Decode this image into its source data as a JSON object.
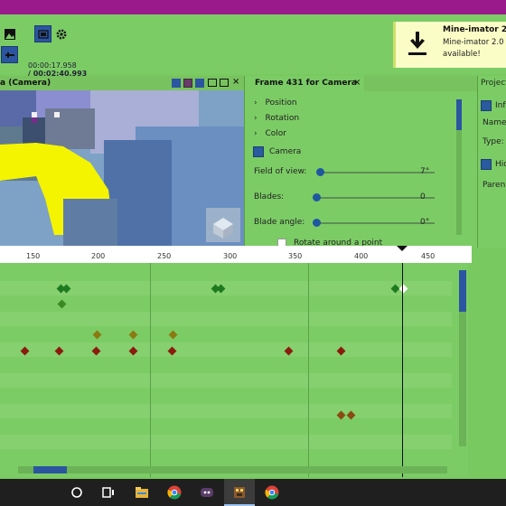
{
  "window": {
    "title_bar_color": "#9a1a8c"
  },
  "toolbar": {
    "time_current": "00:00:17.958",
    "time_total": "/ 00:02:40.993"
  },
  "notification": {
    "title": "Mine-imator 2.0",
    "text_line1": "Mine-imator 2.0 i",
    "text_line2": "available!",
    "icon": "download-icon"
  },
  "viewport": {
    "title": "a (Camera)"
  },
  "frame_panel": {
    "title": "Frame 431 for Camera",
    "close": "×",
    "sections": [
      {
        "label": "Position"
      },
      {
        "label": "Rotation"
      },
      {
        "label": "Color"
      }
    ],
    "camera_label": "Camera",
    "fields": [
      {
        "label": "Field of view:",
        "value": "7°",
        "fraction": 0.0
      },
      {
        "label": "Blades:",
        "value": "0",
        "fraction": 0.0
      },
      {
        "label": "Blade angle:",
        "value": "0°",
        "fraction": 0.0
      }
    ],
    "rotate_label": "Rotate around a point"
  },
  "project_panel": {
    "title": "Project",
    "info_label": "Infor",
    "name_label": "Name",
    "type_label": "Type:",
    "hide_label": "Hid",
    "parent_label": "Paren"
  },
  "timeline": {
    "ruler_labels": [
      "150",
      "200",
      "250",
      "300",
      "350",
      "400",
      "450"
    ],
    "current_frame": 431
  },
  "taskbar": {
    "apps": [
      "search-icon",
      "task-view-icon",
      "file-explorer-icon",
      "chrome-icon",
      "discord-icon",
      "mine-imator-icon",
      "chrome-alt-icon"
    ]
  },
  "colors": {
    "panel_bg": "#7ccc66",
    "keyframe_green": "#1e7a1e",
    "keyframe_olive": "#8b7a12",
    "keyframe_red": "#8a1c0e",
    "keyframe_orange": "#8a4a12",
    "accent_blue": "#2a5aa0"
  }
}
